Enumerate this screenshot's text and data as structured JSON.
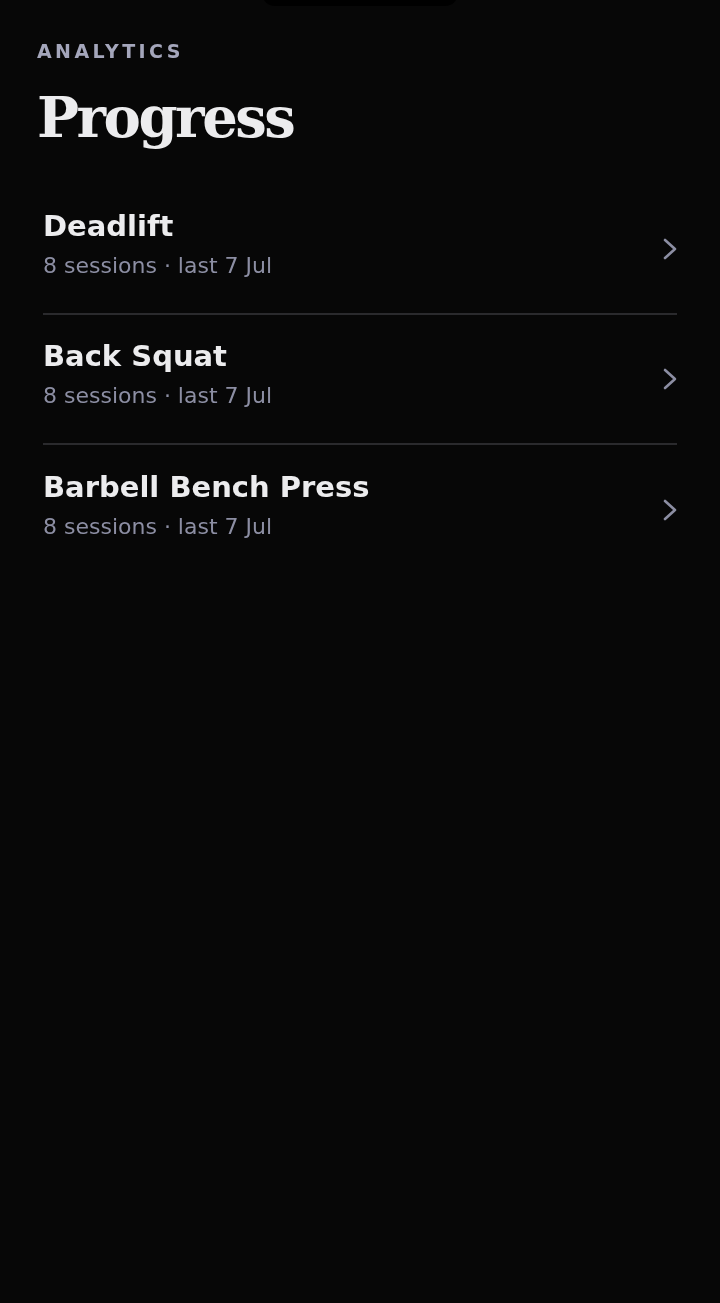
{
  "header": {
    "eyebrow": "ANALYTICS",
    "title": "Progress"
  },
  "exercises": [
    {
      "name": "Deadlift",
      "summary": "8 sessions · last 7 Jul"
    },
    {
      "name": "Back Squat",
      "summary": "8 sessions · last 7 Jul"
    },
    {
      "name": "Barbell Bench Press",
      "summary": "8 sessions · last 7 Jul"
    }
  ]
}
